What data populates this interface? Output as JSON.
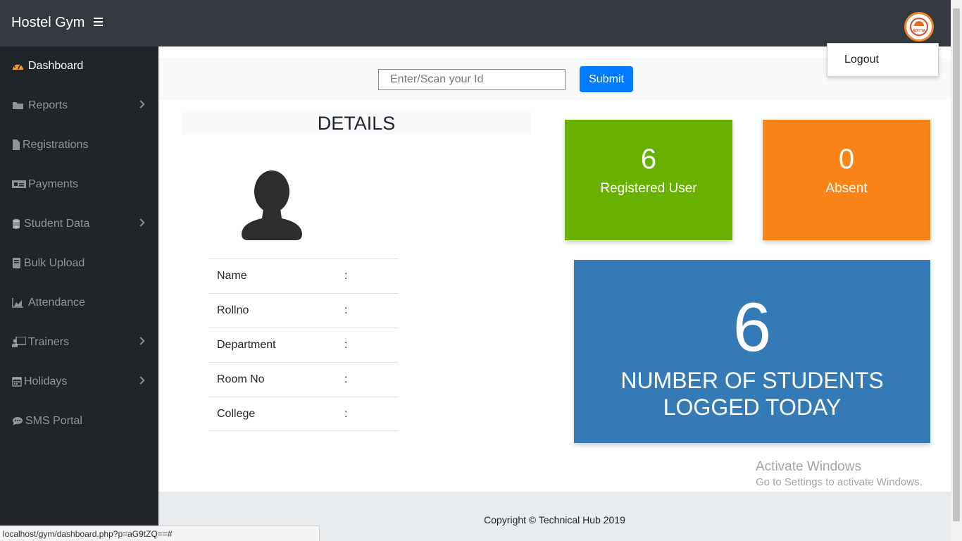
{
  "navbar": {
    "brand": "Hostel Gym",
    "logo_text": "ADITYA"
  },
  "user_menu": {
    "logout_label": "Logout"
  },
  "sidebar": {
    "items": [
      {
        "label": "Dashboard",
        "icon": "tachometer-icon",
        "active": true,
        "has_submenu": false
      },
      {
        "label": "Reports",
        "icon": "folder-icon",
        "active": false,
        "has_submenu": true
      },
      {
        "label": "Registrations",
        "icon": "file-icon",
        "active": false,
        "has_submenu": false
      },
      {
        "label": "Payments",
        "icon": "money-bill-icon",
        "active": false,
        "has_submenu": false
      },
      {
        "label": "Student Data",
        "icon": "database-icon",
        "active": false,
        "has_submenu": true
      },
      {
        "label": "Bulk Upload",
        "icon": "book-icon",
        "active": false,
        "has_submenu": false
      },
      {
        "label": "Attendance",
        "icon": "area-chart-icon",
        "active": false,
        "has_submenu": false
      },
      {
        "label": "Trainers",
        "icon": "chalkboard-teacher-icon",
        "active": false,
        "has_submenu": true
      },
      {
        "label": "Holidays",
        "icon": "calendar-icon",
        "active": false,
        "has_submenu": true
      },
      {
        "label": "SMS Portal",
        "icon": "comment-icon",
        "active": false,
        "has_submenu": false
      }
    ]
  },
  "search": {
    "placeholder": "Enter/Scan your Id",
    "value": "",
    "submit_label": "Submit"
  },
  "details": {
    "title": "DETAILS",
    "separator": ":",
    "fields": [
      {
        "label": "Name",
        "value": ""
      },
      {
        "label": "Rollno",
        "value": ""
      },
      {
        "label": "Department",
        "value": ""
      },
      {
        "label": "Room No",
        "value": ""
      },
      {
        "label": "College",
        "value": ""
      }
    ]
  },
  "stats": {
    "registered": {
      "value": "6",
      "label": "Registered User",
      "color": "#69b100"
    },
    "absent": {
      "value": "0",
      "label": "Absent",
      "color": "#fb8419"
    },
    "logged_today": {
      "value": "6",
      "label_line1": "NUMBER OF STUDENTS",
      "label_line2": "LOGGED TODAY",
      "color": "#337ab7"
    }
  },
  "watermark": {
    "title": "Activate Windows",
    "subtitle": "Go to Settings to activate Windows."
  },
  "footer": {
    "copyright": "Copyright © Technical Hub 2019"
  },
  "statusbar": {
    "url": "localhost/gym/dashboard.php?p=aG9tZQ==#"
  },
  "colors": {
    "navbar": "#343a40",
    "sidebar": "#212529",
    "primary": "#007bff"
  }
}
